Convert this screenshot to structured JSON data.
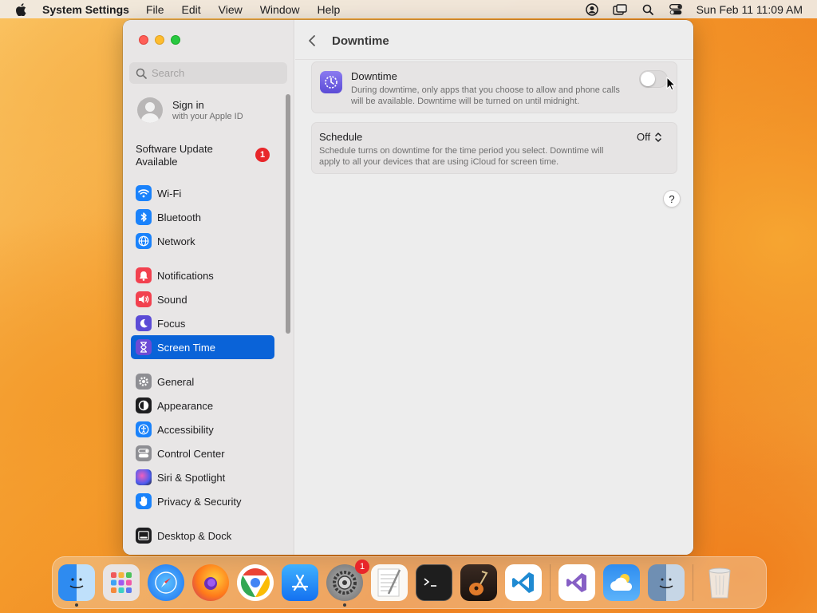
{
  "menubar": {
    "app_name": "System Settings",
    "items": [
      "File",
      "Edit",
      "View",
      "Window",
      "Help"
    ],
    "clock": "Sun Feb 11  11:09 AM"
  },
  "sidebar": {
    "search_placeholder": "Search",
    "signin": {
      "title": "Sign in",
      "subtitle": "with your Apple ID"
    },
    "update": {
      "label_line1": "Software Update",
      "label_line2": "Available",
      "badge": "1"
    },
    "items": [
      {
        "label": "Wi-Fi",
        "icon": "wifi-icon",
        "color": "#1a82fb"
      },
      {
        "label": "Bluetooth",
        "icon": "bluetooth-icon",
        "color": "#1a82fb"
      },
      {
        "label": "Network",
        "icon": "globe-icon",
        "color": "#1a82fb"
      },
      {
        "label": "Notifications",
        "icon": "bell-icon",
        "color": "#f2414f"
      },
      {
        "label": "Sound",
        "icon": "speaker-icon",
        "color": "#f2414f"
      },
      {
        "label": "Focus",
        "icon": "moon-icon",
        "color": "#5b4bd6"
      },
      {
        "label": "Screen Time",
        "icon": "hourglass-icon",
        "color": "#6c4bd6"
      },
      {
        "label": "General",
        "icon": "gear-icon",
        "color": "#8e8e93"
      },
      {
        "label": "Appearance",
        "icon": "appearance-icon",
        "color": "#1d1d1f"
      },
      {
        "label": "Accessibility",
        "icon": "accessibility-icon",
        "color": "#1a82fb"
      },
      {
        "label": "Control Center",
        "icon": "control-center-icon",
        "color": "#8e8e93"
      },
      {
        "label": "Siri & Spotlight",
        "icon": "siri-icon",
        "color": "#7a3fd0"
      },
      {
        "label": "Privacy & Security",
        "icon": "hand-icon",
        "color": "#1a82fb"
      },
      {
        "label": "Desktop & Dock",
        "icon": "dock-icon",
        "color": "#1d1d1f"
      }
    ],
    "active": "Screen Time"
  },
  "content": {
    "title": "Downtime",
    "downtime": {
      "title": "Downtime",
      "description": "During downtime, only apps that you choose to allow and phone calls will be available. Downtime will be turned on until midnight.",
      "enabled": false
    },
    "schedule": {
      "title": "Schedule",
      "description": "Schedule turns on downtime for the time period you select. Downtime will apply to all your devices that are using iCloud for screen time.",
      "value": "Off"
    },
    "help_label": "?"
  },
  "dock": {
    "apps": [
      {
        "name": "Finder",
        "icon": "finder-icon",
        "running": true
      },
      {
        "name": "Launchpad",
        "icon": "launchpad-icon",
        "running": false
      },
      {
        "name": "Safari",
        "icon": "safari-icon",
        "running": false
      },
      {
        "name": "Firefox",
        "icon": "firefox-icon",
        "running": false
      },
      {
        "name": "Chrome",
        "icon": "chrome-icon",
        "running": false
      },
      {
        "name": "App Store",
        "icon": "app-store-icon",
        "running": false
      },
      {
        "name": "System Settings",
        "icon": "system-settings-icon",
        "running": true,
        "badge": "1"
      },
      {
        "name": "TextEdit",
        "icon": "textedit-icon",
        "running": false
      },
      {
        "name": "Terminal",
        "icon": "terminal-icon",
        "running": false
      },
      {
        "name": "GarageBand",
        "icon": "garageband-icon",
        "running": false
      },
      {
        "name": "VS Code",
        "icon": "vscode-icon",
        "running": false
      },
      {
        "name": "Visual Studio",
        "icon": "visual-studio-icon",
        "running": false
      },
      {
        "name": "Weather",
        "icon": "weather-icon",
        "running": false
      },
      {
        "name": "Finder Folder",
        "icon": "finder-folder-icon",
        "running": false
      },
      {
        "name": "Trash",
        "icon": "trash-icon",
        "running": false
      }
    ]
  }
}
